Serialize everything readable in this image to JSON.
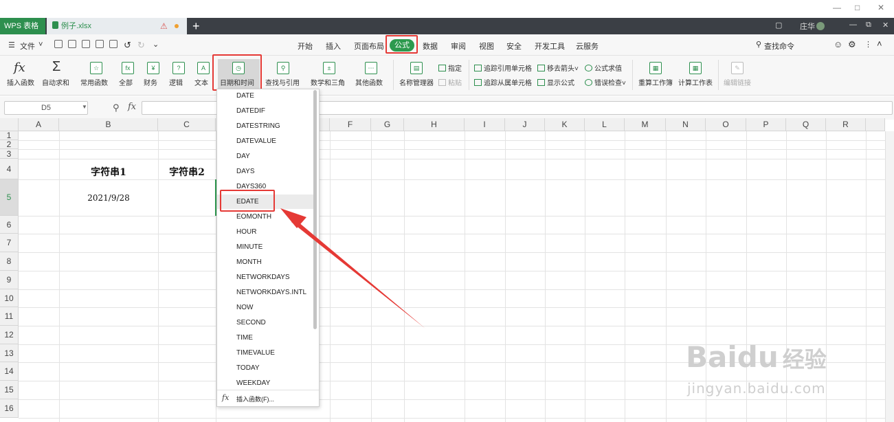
{
  "window": {
    "app_tab": "WPS 表格",
    "file_tab": "例子.xlsx",
    "user": "庄华"
  },
  "menu": {
    "file": "文件",
    "tabs": [
      "开始",
      "插入",
      "页面布局",
      "公式",
      "数据",
      "审阅",
      "视图",
      "安全",
      "开发工具",
      "云服务"
    ],
    "active_tab": "公式",
    "search": "查找命令"
  },
  "ribbon": {
    "insert_function": "插入函数",
    "autosum": "自动求和",
    "common_func": "常用函数",
    "all": "全部",
    "finance": "财务",
    "logic": "逻辑",
    "text": "文本",
    "datetime": "日期和时间",
    "lookup": "查找与引用",
    "math": "数学和三角",
    "other": "其他函数",
    "name_manager": "名称管理器",
    "specify": "指定",
    "paste": "粘贴",
    "trace_precedents": "追踪引用单元格",
    "trace_dependents": "追踪从属单元格",
    "remove_arrows": "移去箭头",
    "show_formula": "显示公式",
    "evaluate": "公式求值",
    "error_check": "错误检查",
    "recalc_book": "重算工作簿",
    "calc_sheet": "计算工作表",
    "edit_links": "编辑链接"
  },
  "formula_bar": {
    "name_box": "D5",
    "fx": "fx",
    "content": ""
  },
  "sheet": {
    "columns": [
      "A",
      "B",
      "C",
      "",
      "",
      "F",
      "G",
      "H",
      "I",
      "J",
      "K",
      "L",
      "M",
      "N",
      "O",
      "P",
      "Q",
      "R"
    ],
    "rows": [
      "1",
      "2",
      "3",
      "4",
      "5",
      "6",
      "7",
      "8",
      "9",
      "10",
      "11",
      "12",
      "13",
      "14",
      "15",
      "16"
    ],
    "b4": "字符串1",
    "c4": "字符串2",
    "b5": "2021/9/28"
  },
  "dropdown": {
    "items": [
      "DATE",
      "DATEDIF",
      "DATESTRING",
      "DATEVALUE",
      "DAY",
      "DAYS",
      "DAYS360",
      "EDATE",
      "EOMONTH",
      "HOUR",
      "MINUTE",
      "MONTH",
      "NETWORKDAYS",
      "NETWORKDAYS.INTL",
      "NOW",
      "SECOND",
      "TIME",
      "TIMEVALUE",
      "TODAY",
      "WEEKDAY"
    ],
    "highlighted": "EDATE",
    "insert_function": "插入函数(F)..."
  },
  "watermark": {
    "brand": "Baidu",
    "brand_cn": "经验",
    "url": "jingyan.baidu.com"
  },
  "colors": {
    "accent": "#2d9a4e",
    "highlight_box": "#e53935"
  }
}
